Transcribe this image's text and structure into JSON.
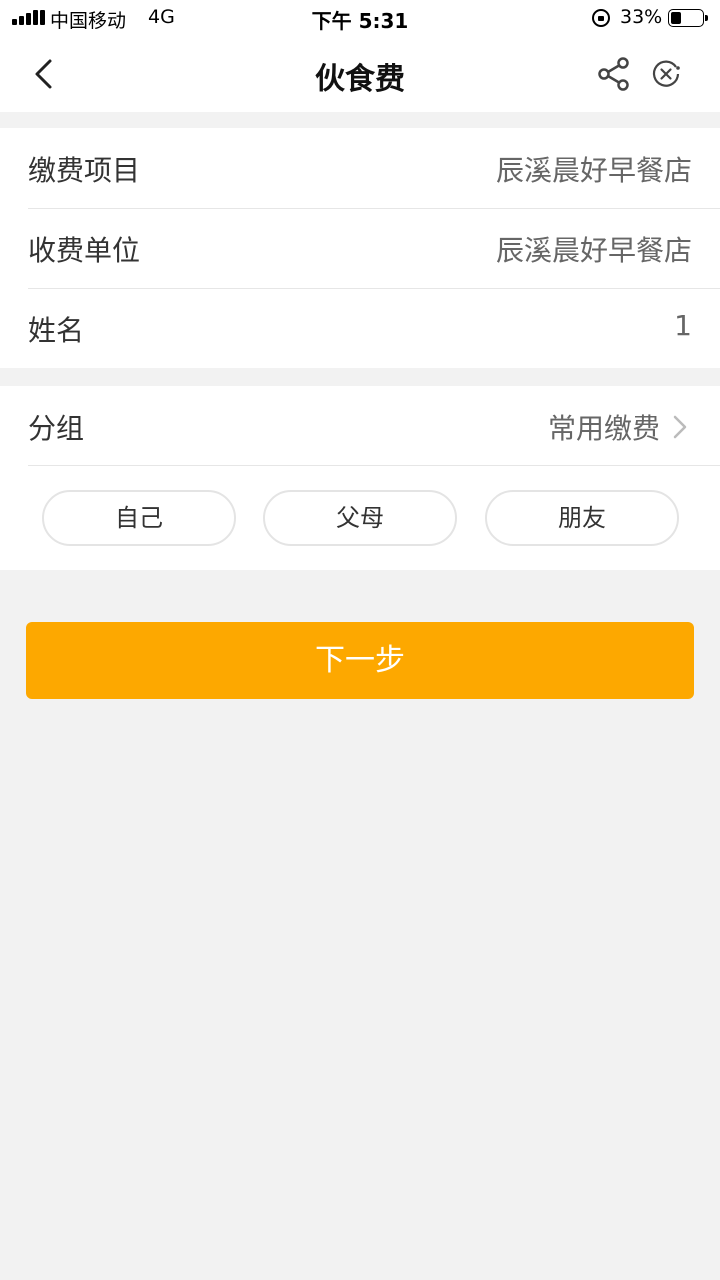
{
  "status_bar": {
    "carrier": "中国移动",
    "network": "4G",
    "time": "下午 5:31",
    "battery": "33%",
    "battery_level": 0.33
  },
  "nav": {
    "title": "伙食费",
    "back_icon": "chevron-left-icon",
    "share_icon": "share-icon",
    "close_icon": "close-circle-icon"
  },
  "info": {
    "rows": [
      {
        "label": "缴费项目",
        "value": "辰溪晨好早餐店"
      },
      {
        "label": "收费单位",
        "value": "辰溪晨好早餐店"
      },
      {
        "label": "姓名",
        "value": "1"
      }
    ]
  },
  "group": {
    "label": "分组",
    "value": "常用缴费",
    "chips": [
      "自己",
      "父母",
      "朋友"
    ]
  },
  "next_button": {
    "label": "下一步"
  },
  "colors": {
    "accent": "#fda800",
    "background": "#f2f2f2"
  }
}
